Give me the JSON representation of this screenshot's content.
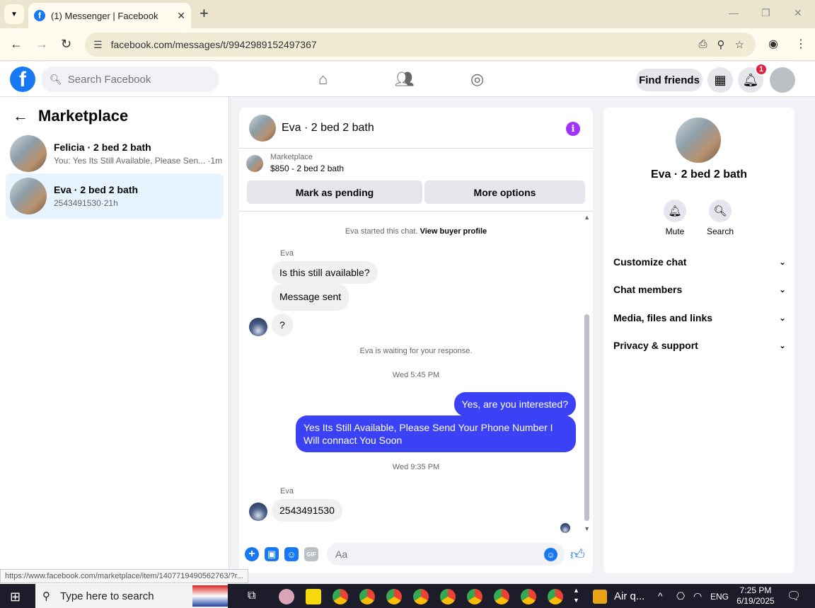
{
  "browser": {
    "tab_title": "(1) Messenger | Facebook",
    "url": "facebook.com/messages/t/9942989152497367",
    "status_url": "https://www.facebook.com/marketplace/item/1407719490562763/?r..."
  },
  "fb_header": {
    "search_placeholder": "Search Facebook",
    "find_friends": "Find friends",
    "notification_count": "1"
  },
  "left": {
    "title": "Marketplace",
    "conversations": [
      {
        "name": "Felicia · 2 bed 2 bath",
        "preview": "You: Yes Its Still Available, Please Sen...",
        "time": "·1m"
      },
      {
        "name": "Eva · 2 bed 2 bath",
        "preview": "2543491530",
        "time": "·21h"
      }
    ]
  },
  "chat": {
    "title": "Eva · 2 bed 2 bath",
    "marketplace_label": "Marketplace",
    "listing": "$850 - 2 bed 2 bath",
    "mark_pending": "Mark as pending",
    "more_options": "More options",
    "started_text": "Eva started this chat.",
    "view_profile": "View buyer profile",
    "sender_name": "Eva",
    "msg1": "Is this still available?",
    "msg2": "Message sent",
    "msg3": "?",
    "waiting_text": "Eva is waiting for your response.",
    "time1": "Wed 5:45 PM",
    "out1": "Yes, are you interested?",
    "out2": "Yes Its Still Available, Please Send Your Phone Number I Will connact You Soon",
    "time2": "Wed 9:35 PM",
    "msg4": "2543491530",
    "composer_placeholder": "Aa"
  },
  "right": {
    "name": "Eva · 2 bed 2 bath",
    "mute": "Mute",
    "search": "Search",
    "sections": [
      "Customize chat",
      "Chat members",
      "Media, files and links",
      "Privacy & support"
    ]
  },
  "taskbar": {
    "search_placeholder": "Type here to search",
    "weather": "Air q...",
    "lang": "ENG",
    "time": "7:25 PM",
    "date": "6/19/2025"
  },
  "colors": {
    "fb_blue": "#1877f2",
    "outgoing_bubble": "#3b42f5",
    "active_convo": "#e7f3ff",
    "info_purple": "#a033ff"
  }
}
